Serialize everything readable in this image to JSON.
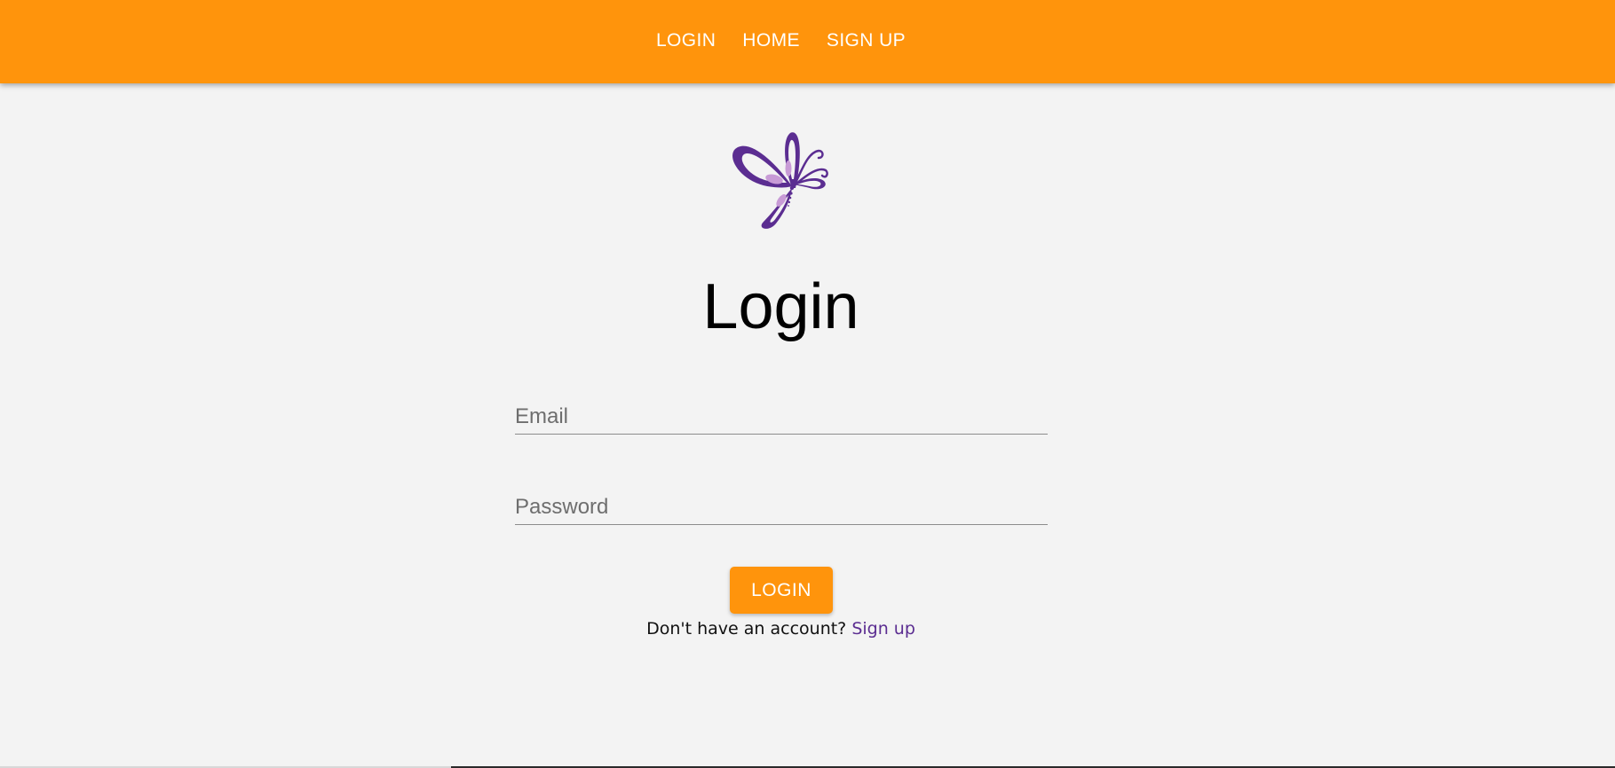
{
  "nav": {
    "login": "LOGIN",
    "home": "HOME",
    "signup": "SIGN UP"
  },
  "logo": {
    "icon": "butterfly-icon",
    "color_primary": "#5b2d91",
    "color_accent": "#c89bd6"
  },
  "main": {
    "title": "Login",
    "email_placeholder": "Email",
    "email_value": "",
    "password_placeholder": "Password",
    "password_value": "",
    "login_button_label": "LOGIN",
    "signup_prompt": "Don't have an account?",
    "signup_link": "Sign up"
  },
  "colors": {
    "header_bg": "#ff940c",
    "page_bg": "#f3f3f3",
    "link": "#5b2d91"
  }
}
